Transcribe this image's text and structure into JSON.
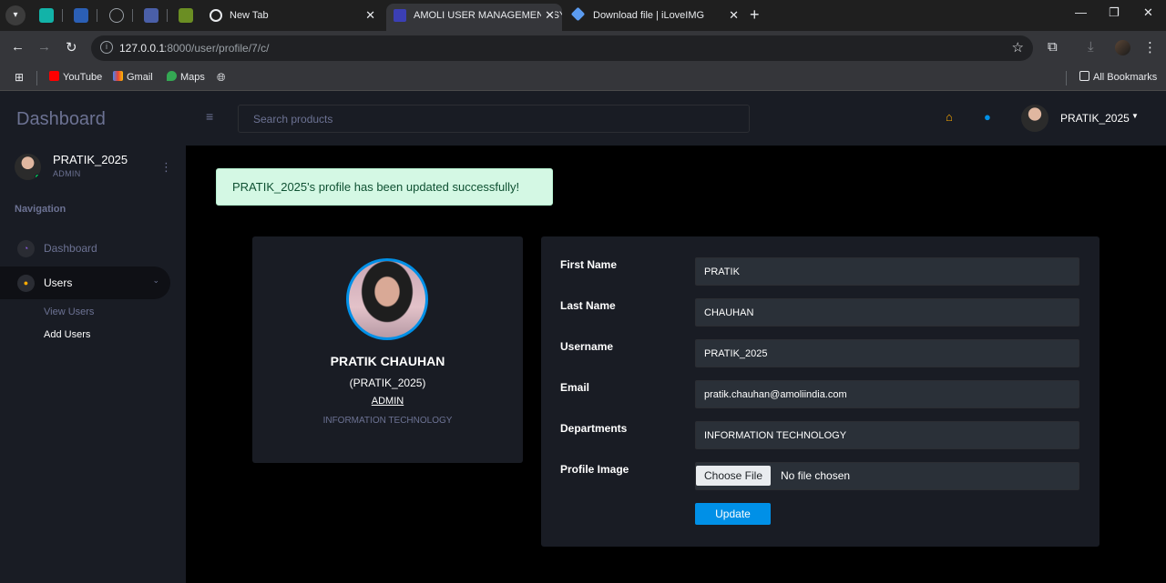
{
  "browser": {
    "tabs": [
      {
        "title": "New Tab",
        "active": false
      },
      {
        "title": "AMOLI USER MANAGEMENT SY",
        "active": true
      },
      {
        "title": "Download file | iLoveIMG",
        "active": false
      }
    ],
    "url_host": "127.0.0.1",
    "url_path": ":8000/user/profile/7/c/",
    "bookmarks": [
      "YouTube",
      "Gmail",
      "Maps"
    ],
    "all_bookmarks": "All Bookmarks"
  },
  "sidebar": {
    "brand": "Dashboard",
    "user_name": "PRATIK_2025",
    "user_role": "ADMIN",
    "nav_heading": "Navigation",
    "items": [
      {
        "label": "Dashboard"
      },
      {
        "label": "Users"
      }
    ],
    "sub_items": [
      {
        "label": "View Users"
      },
      {
        "label": "Add Users"
      }
    ]
  },
  "topnav": {
    "search_placeholder": "Search products",
    "user_name": "PRATIK_2025"
  },
  "alert": {
    "message": "PRATIK_2025's profile has been updated successfully!"
  },
  "profile_card": {
    "full_name": "PRATIK CHAUHAN",
    "username": "(PRATIK_2025)",
    "role": "ADMIN",
    "department": "INFORMATION TECHNOLOGY"
  },
  "form": {
    "fields": [
      {
        "label": "First Name",
        "value": "PRATIK"
      },
      {
        "label": "Last Name",
        "value": "CHAUHAN"
      },
      {
        "label": "Username",
        "value": "PRATIK_2025"
      },
      {
        "label": "Email",
        "value": "pratik.chauhan@amoliindia.com"
      },
      {
        "label": "Departments",
        "value": "INFORMATION TECHNOLOGY"
      }
    ],
    "profile_image_label": "Profile Image",
    "choose_file": "Choose File",
    "no_file": "No file chosen",
    "update_button": "Update"
  },
  "colors": {
    "accent": "#0090e7",
    "success_bg": "#d4f8e4",
    "card_bg": "#191c24",
    "home_icon": "#ffab00",
    "online": "#00d25b"
  }
}
